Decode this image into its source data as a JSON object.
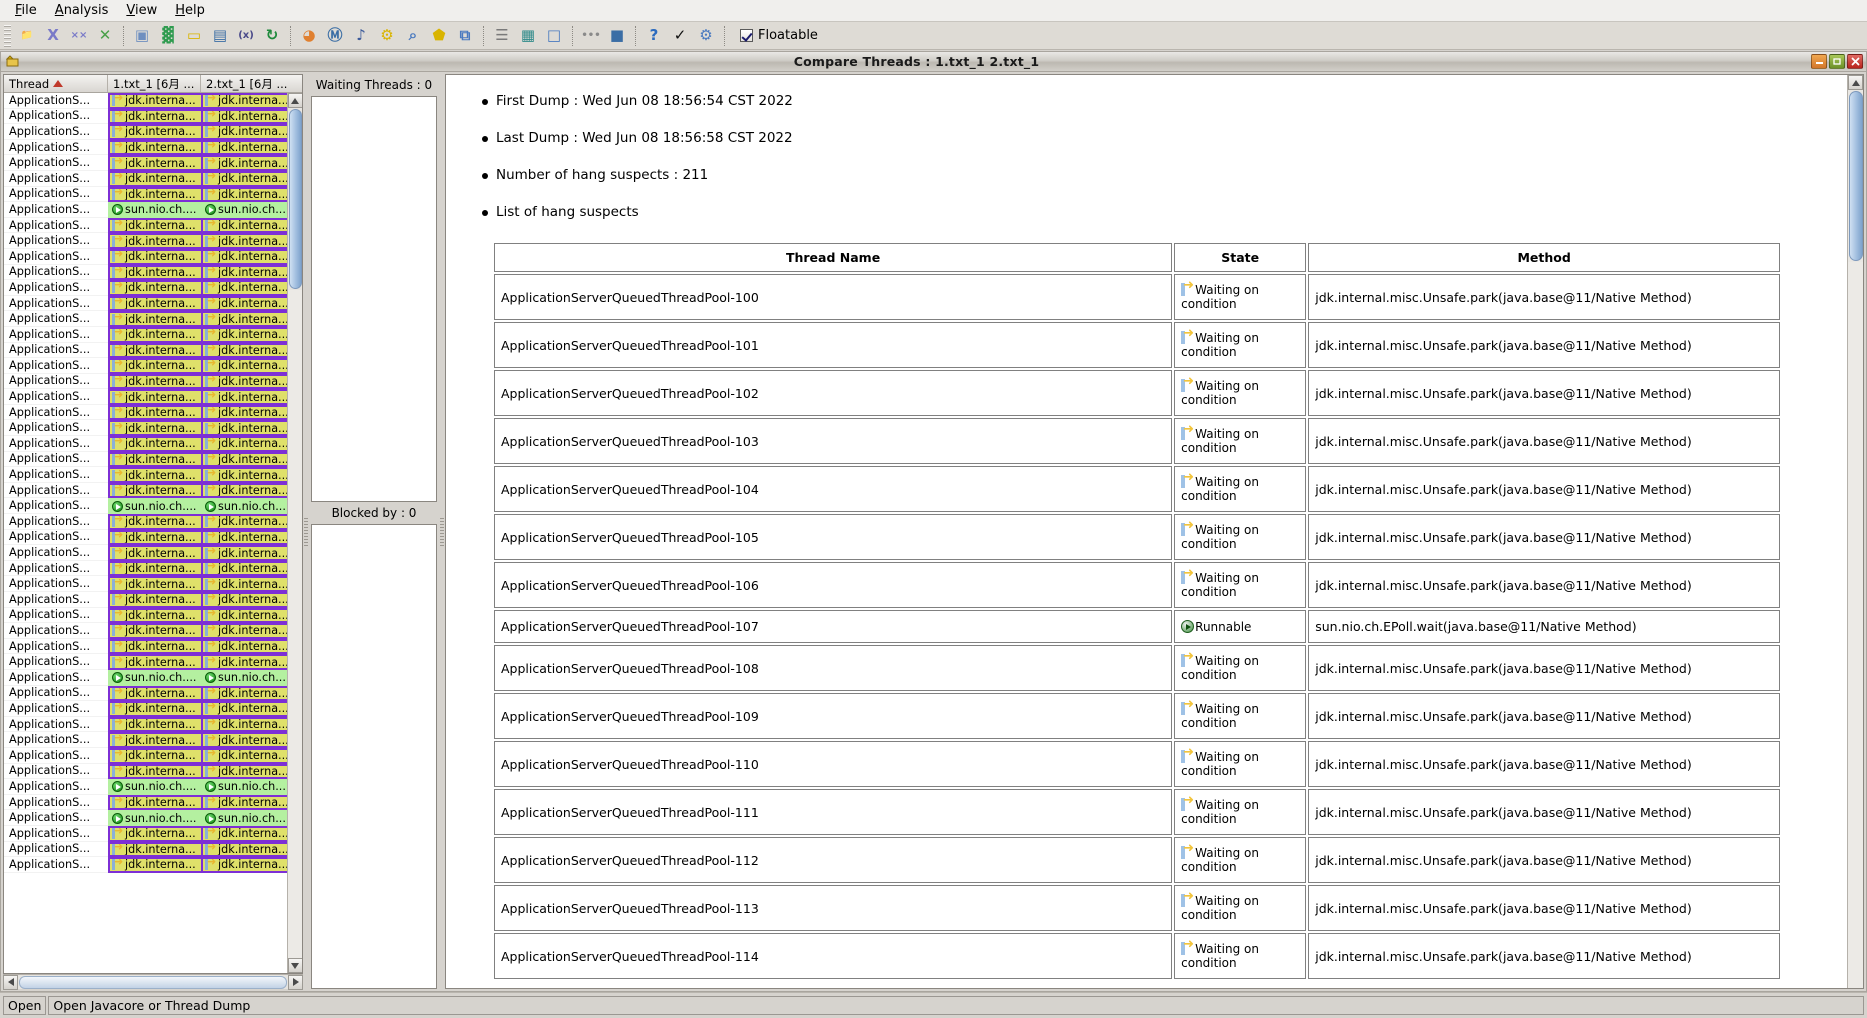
{
  "menubar": {
    "items": [
      {
        "mnemonic": "F",
        "rest": "ile",
        "name": "menu-file"
      },
      {
        "mnemonic": "A",
        "rest": "nalysis",
        "name": "menu-analysis"
      },
      {
        "mnemonic": "V",
        "rest": "iew",
        "name": "menu-view"
      },
      {
        "mnemonic": "H",
        "rest": "elp",
        "name": "menu-help"
      }
    ]
  },
  "toolbar": {
    "buttons": [
      {
        "icon": "open-folder-icon",
        "glyph": "📁",
        "color": "#e8c44a"
      },
      {
        "icon": "close-x-icon",
        "glyph": "X",
        "color": "#7a7ac8"
      },
      {
        "icon": "close-all-xx-icon",
        "glyph": "××",
        "color": "#7a7ac8"
      },
      {
        "icon": "delete-x-icon",
        "glyph": "✕",
        "color": "#4aa04a"
      },
      {
        "icon": "cpu-chip-icon",
        "glyph": "▣",
        "color": "#6f8fc0"
      },
      {
        "icon": "memory-ram-icon",
        "glyph": "▓",
        "color": "#2f9b4f"
      },
      {
        "icon": "container-icon",
        "glyph": "▭",
        "color": "#d9b400"
      },
      {
        "icon": "window-list-icon",
        "glyph": "▤",
        "color": "#3b6ea5"
      },
      {
        "icon": "variable-x-icon",
        "glyph": "(x)",
        "color": "#4a4a8a"
      },
      {
        "icon": "refresh-gc-icon",
        "glyph": "↻",
        "color": "#1f8a3c"
      },
      {
        "icon": "pie-chart-icon",
        "glyph": "◕",
        "color": "#e08030"
      },
      {
        "icon": "monitor-m-icon",
        "glyph": "Ⓜ",
        "color": "#3b6ea5"
      },
      {
        "icon": "thread-dump-icon",
        "glyph": "♪",
        "color": "#3b5a9a"
      },
      {
        "icon": "gear-icon",
        "glyph": "⚙",
        "color": "#d9b400"
      },
      {
        "icon": "compare-search-icon",
        "glyph": "⌕",
        "color": "#4a7ac0"
      },
      {
        "icon": "tag-icon",
        "glyph": "⬟",
        "color": "#d9b400"
      },
      {
        "icon": "copy-windows-icon",
        "glyph": "⧉",
        "color": "#4a7ac0"
      },
      {
        "icon": "checklist-icon",
        "glyph": "☰",
        "color": "#7a7a7a"
      },
      {
        "icon": "grid-pattern-icon",
        "glyph": "▦",
        "color": "#2f8a8a"
      },
      {
        "icon": "monitor-blank-icon",
        "glyph": "□",
        "color": "#4a7ac0"
      },
      {
        "icon": "dashes-icon",
        "glyph": "•••",
        "color": "#8a8a8a"
      },
      {
        "icon": "monitor-filled-icon",
        "glyph": "■",
        "color": "#3b6ea5"
      },
      {
        "icon": "help-question-icon",
        "glyph": "?",
        "color": "#2b6bbf"
      },
      {
        "icon": "check-mark-icon",
        "glyph": "✓",
        "color": "#111111"
      },
      {
        "icon": "preferences-icon",
        "glyph": "⚙",
        "color": "#4a7ac0"
      }
    ],
    "separators_after": [
      3,
      9,
      16,
      19,
      21
    ],
    "floatable_label": "Floatable",
    "floatable_checked": true
  },
  "window": {
    "title": "Compare Threads : 1.txt_1 2.txt_1",
    "minimize_label": "–",
    "maximize_label": "❐",
    "close_label": "✕"
  },
  "left_table": {
    "columns": [
      {
        "label": "Thread",
        "sorted": true,
        "name": "column-thread"
      },
      {
        "label": "1.txt_1 [6月 ...",
        "sorted": false,
        "name": "column-file1"
      },
      {
        "label": "2.txt_1 [6月 ...",
        "sorted": false,
        "name": "column-file2"
      }
    ],
    "thread_label": "ApplicationS...",
    "waiting_text": "jdk.interna...",
    "runnable_text": "sun.nio.ch....",
    "rows": [
      "waiting",
      "waiting",
      "waiting",
      "waiting",
      "waiting",
      "waiting",
      "waiting",
      "runnable",
      "waiting",
      "waiting",
      "waiting",
      "waiting",
      "waiting",
      "waiting",
      "waiting",
      "waiting",
      "waiting",
      "waiting",
      "waiting",
      "waiting",
      "waiting",
      "waiting",
      "waiting",
      "waiting",
      "waiting",
      "waiting",
      "runnable",
      "waiting",
      "waiting",
      "waiting",
      "waiting",
      "waiting",
      "waiting",
      "waiting",
      "waiting",
      "waiting",
      "waiting",
      "runnable",
      "waiting",
      "waiting",
      "waiting",
      "waiting",
      "waiting",
      "waiting",
      "runnable",
      "waiting",
      "runnable",
      "waiting",
      "waiting",
      "waiting"
    ]
  },
  "middle": {
    "waiting_threads_title": "Waiting Threads : 0",
    "blocked_by_title": "Blocked by : 0"
  },
  "main": {
    "bullets": [
      "First Dump : Wed Jun 08 18:56:54 CST 2022",
      "Last Dump : Wed Jun 08 18:56:58 CST 2022",
      "Number of hang suspects : 211",
      "List of hang suspects"
    ],
    "table": {
      "headers": [
        "Thread Name",
        "State",
        "Method"
      ],
      "state_waiting_label": "Waiting on condition",
      "state_runnable_label": "Runnable",
      "rows": [
        {
          "name": "ApplicationServerQueuedThreadPool-100",
          "state": "Waiting on condition",
          "state_kind": "waiting",
          "method": "jdk.internal.misc.Unsafe.park(java.base@11/Native Method)"
        },
        {
          "name": "ApplicationServerQueuedThreadPool-101",
          "state": "Waiting on condition",
          "state_kind": "waiting",
          "method": "jdk.internal.misc.Unsafe.park(java.base@11/Native Method)"
        },
        {
          "name": "ApplicationServerQueuedThreadPool-102",
          "state": "Waiting on condition",
          "state_kind": "waiting",
          "method": "jdk.internal.misc.Unsafe.park(java.base@11/Native Method)"
        },
        {
          "name": "ApplicationServerQueuedThreadPool-103",
          "state": "Waiting on condition",
          "state_kind": "waiting",
          "method": "jdk.internal.misc.Unsafe.park(java.base@11/Native Method)"
        },
        {
          "name": "ApplicationServerQueuedThreadPool-104",
          "state": "Waiting on condition",
          "state_kind": "waiting",
          "method": "jdk.internal.misc.Unsafe.park(java.base@11/Native Method)"
        },
        {
          "name": "ApplicationServerQueuedThreadPool-105",
          "state": "Waiting on condition",
          "state_kind": "waiting",
          "method": "jdk.internal.misc.Unsafe.park(java.base@11/Native Method)"
        },
        {
          "name": "ApplicationServerQueuedThreadPool-106",
          "state": "Waiting on condition",
          "state_kind": "waiting",
          "method": "jdk.internal.misc.Unsafe.park(java.base@11/Native Method)"
        },
        {
          "name": "ApplicationServerQueuedThreadPool-107",
          "state": "Runnable",
          "state_kind": "runnable",
          "method": "sun.nio.ch.EPoll.wait(java.base@11/Native Method)"
        },
        {
          "name": "ApplicationServerQueuedThreadPool-108",
          "state": "Waiting on condition",
          "state_kind": "waiting",
          "method": "jdk.internal.misc.Unsafe.park(java.base@11/Native Method)"
        },
        {
          "name": "ApplicationServerQueuedThreadPool-109",
          "state": "Waiting on condition",
          "state_kind": "waiting",
          "method": "jdk.internal.misc.Unsafe.park(java.base@11/Native Method)"
        },
        {
          "name": "ApplicationServerQueuedThreadPool-110",
          "state": "Waiting on condition",
          "state_kind": "waiting",
          "method": "jdk.internal.misc.Unsafe.park(java.base@11/Native Method)"
        },
        {
          "name": "ApplicationServerQueuedThreadPool-111",
          "state": "Waiting on condition",
          "state_kind": "waiting",
          "method": "jdk.internal.misc.Unsafe.park(java.base@11/Native Method)"
        },
        {
          "name": "ApplicationServerQueuedThreadPool-112",
          "state": "Waiting on condition",
          "state_kind": "waiting",
          "method": "jdk.internal.misc.Unsafe.park(java.base@11/Native Method)"
        },
        {
          "name": "ApplicationServerQueuedThreadPool-113",
          "state": "Waiting on condition",
          "state_kind": "waiting",
          "method": "jdk.internal.misc.Unsafe.park(java.base@11/Native Method)"
        },
        {
          "name": "ApplicationServerQueuedThreadPool-114",
          "state": "Waiting on condition",
          "state_kind": "waiting",
          "method": "jdk.internal.misc.Unsafe.park(java.base@11/Native Method)"
        }
      ]
    }
  },
  "statusbar": {
    "left": "Open",
    "main": "Open Javacore or Thread Dump"
  },
  "colors": {
    "waiting_purple": "#8120d8",
    "runnable_green": "#72e06a",
    "grid_yellow": "#dfe06a",
    "grid_purple_border": "#7d2fd6"
  }
}
